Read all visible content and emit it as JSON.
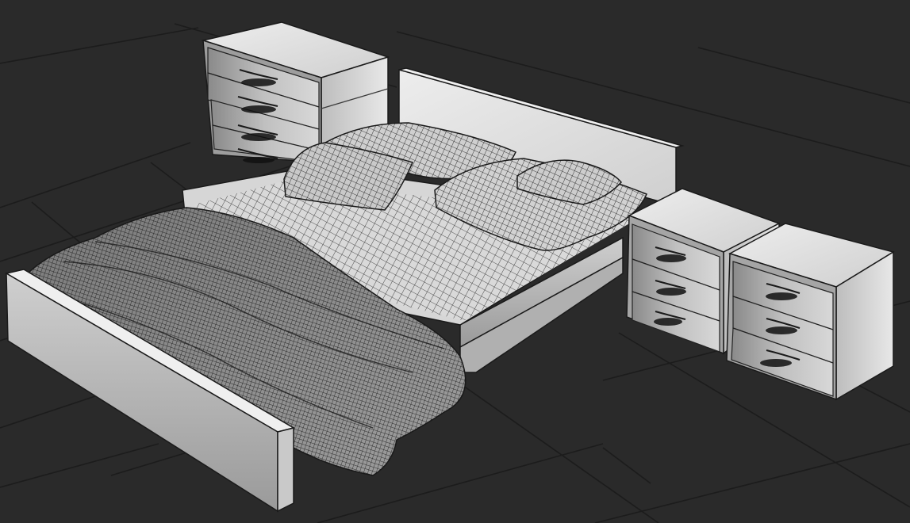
{
  "viewport": {
    "background": "#2a2a2a",
    "grid_color": "#1c1c1c",
    "shading": "clay-with-wireframe"
  },
  "objects": [
    {
      "name": "bed-frame"
    },
    {
      "name": "mattress"
    },
    {
      "name": "throw-blanket"
    },
    {
      "name": "headboard"
    },
    {
      "name": "pillow"
    },
    {
      "name": "dresser"
    },
    {
      "name": "nightstand"
    }
  ],
  "colors": {
    "furniture_light": "#d2d2d2",
    "furniture_mid": "#b4b4b4",
    "furniture_dark": "#8c8c8c",
    "wire": "#111111",
    "handle": "#cfcfcf"
  }
}
